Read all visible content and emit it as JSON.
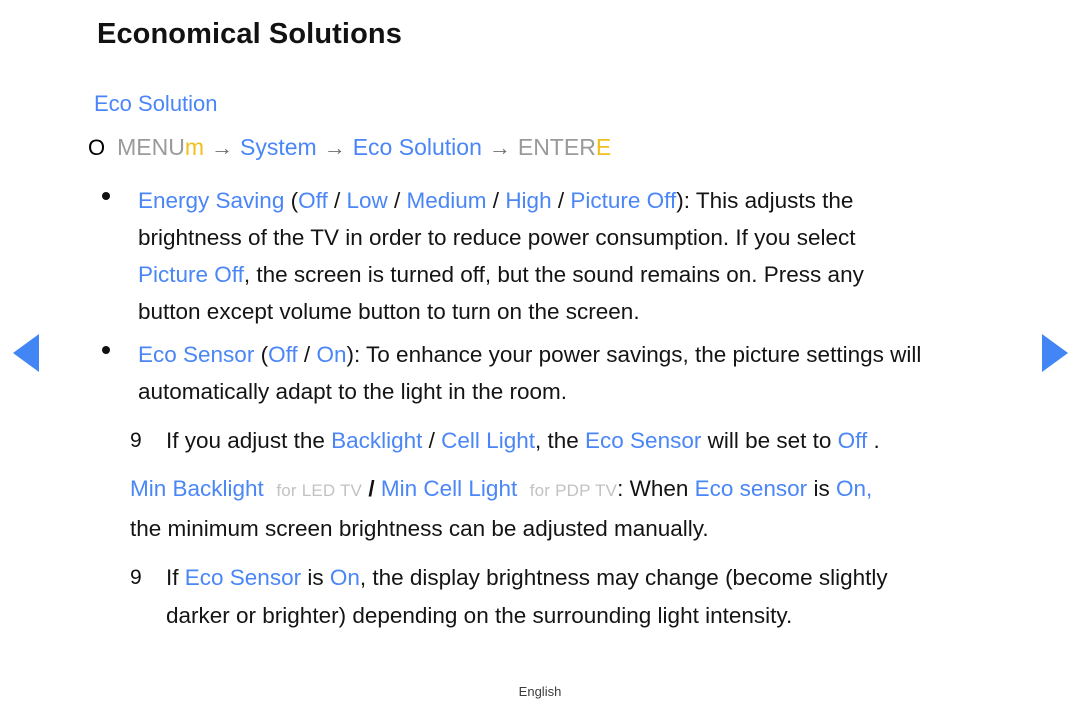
{
  "page": {
    "title": "Economical Solutions",
    "section_title": "Eco Solution",
    "footer": "English"
  },
  "menu_path": {
    "circle_key": "O",
    "menu_label": "MENU",
    "menu_key": "m",
    "sep1": "→",
    "step1": "System",
    "sep2": "→",
    "step2": "Eco Solution",
    "sep3": "→",
    "enter_label": "ENTER",
    "enter_key": "E"
  },
  "bullets": [
    {
      "term": "Energy Saving",
      "open_paren": " (",
      "options": [
        "Off",
        "Low",
        "Medium",
        "High",
        "Picture Off"
      ],
      "option_sep": " / ",
      "close_paren": "): ",
      "line1_tail": "This adjusts the",
      "line2_text": "brightness of the TV in order to reduce power consumption. If you select",
      "line3_term": "Picture Off",
      "line3_tail": ", the screen is turned off, but the sound remains on. Press any",
      "line4_text": "button except volume button to turn on the screen."
    },
    {
      "term": "Eco Sensor",
      "open_paren": " (",
      "options": [
        "Off",
        "On"
      ],
      "option_sep": " / ",
      "close_paren": "): ",
      "line1_tail": "To enhance your power savings, the picture settings will",
      "line2_text": "automatically adapt to the light in the room."
    }
  ],
  "notes": [
    {
      "mark": "9",
      "seg1": "If you adjust the ",
      "term1": "Backlight",
      "seg2": " / ",
      "term2": "Cell Light",
      "seg3": ", the ",
      "term3": "Eco Sensor",
      "seg4": " will be set to ",
      "term4": "Off",
      "seg5": " ."
    }
  ],
  "min_backlight": {
    "term1": "Min Backlight",
    "small1": "for LED TV",
    "slash": "/",
    "term2": "Min Cell Light",
    "small2": "for PDP TV",
    "seg1": ": When ",
    "term3": "Eco sensor",
    "seg2": " is ",
    "term4": "On,",
    "line2": "the minimum screen brightness can be adjusted manually."
  },
  "note2": {
    "mark": "9",
    "seg1": "If ",
    "term1": "Eco Sensor",
    "seg2": " is ",
    "term2": "On",
    "seg3": ", the display brightness may change (become slightly",
    "line2": "darker or brighter) depending on the surrounding light intensity."
  },
  "nav": {
    "prev_label": "previous-page",
    "next_label": "next-page"
  },
  "colors": {
    "accent_blue": "#4a86f7",
    "key_gold": "#f0bf1f",
    "key_gray": "#9a9a9a",
    "small_gray": "#c2c2c2"
  }
}
